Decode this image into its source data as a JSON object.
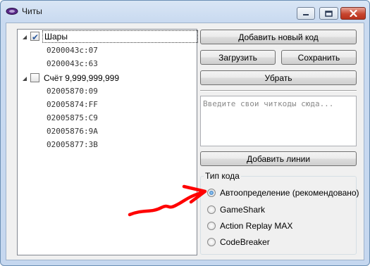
{
  "window": {
    "title": "Читы",
    "brand_color": "#5a2a8a"
  },
  "title_buttons": {
    "minimize_icon": "minimize-icon",
    "maximize_icon": "maximize-icon",
    "close_icon": "close-icon"
  },
  "tree": {
    "nodes": [
      {
        "label": "Шары",
        "checked": true,
        "expanded": true,
        "codes": [
          "0200043c:07",
          "0200043c:63"
        ]
      },
      {
        "label": "Счёт 9,999,999,999",
        "checked": false,
        "expanded": true,
        "codes": [
          "02005870:09",
          "02005874:FF",
          "02005875:C9",
          "02005876:9A",
          "02005877:3B"
        ]
      }
    ]
  },
  "buttons": {
    "add_new_code": "Добавить новый код",
    "load": "Загрузить",
    "save": "Сохранить",
    "remove": "Убрать",
    "add_lines": "Добавить линии"
  },
  "code_input": {
    "placeholder": "Введите свои читкоды сюда..."
  },
  "code_type": {
    "title": "Тип кода",
    "options": [
      {
        "label": "Автоопределение (рекомендовано)",
        "selected": true
      },
      {
        "label": "GameShark",
        "selected": false
      },
      {
        "label": "Action Replay MAX",
        "selected": false
      },
      {
        "label": "CodeBreaker",
        "selected": false
      }
    ]
  },
  "annotation": {
    "color": "#ff0000"
  }
}
